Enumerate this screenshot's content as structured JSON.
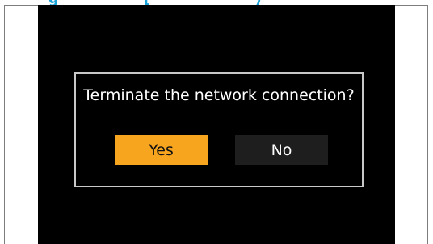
{
  "heading": {
    "fragment_left": "g",
    "fragment_right": "[",
    "fragment_end": ")"
  },
  "dialog": {
    "message": "Terminate the network connection?",
    "yes_label": "Yes",
    "no_label": "No",
    "selected": "Yes"
  },
  "colors": {
    "heading": "#1aa3d9",
    "screen_background": "#000000",
    "dialog_border": "#c8c8c8",
    "selected_button": "#f7a41f",
    "unselected_button": "#1e1e1e"
  }
}
